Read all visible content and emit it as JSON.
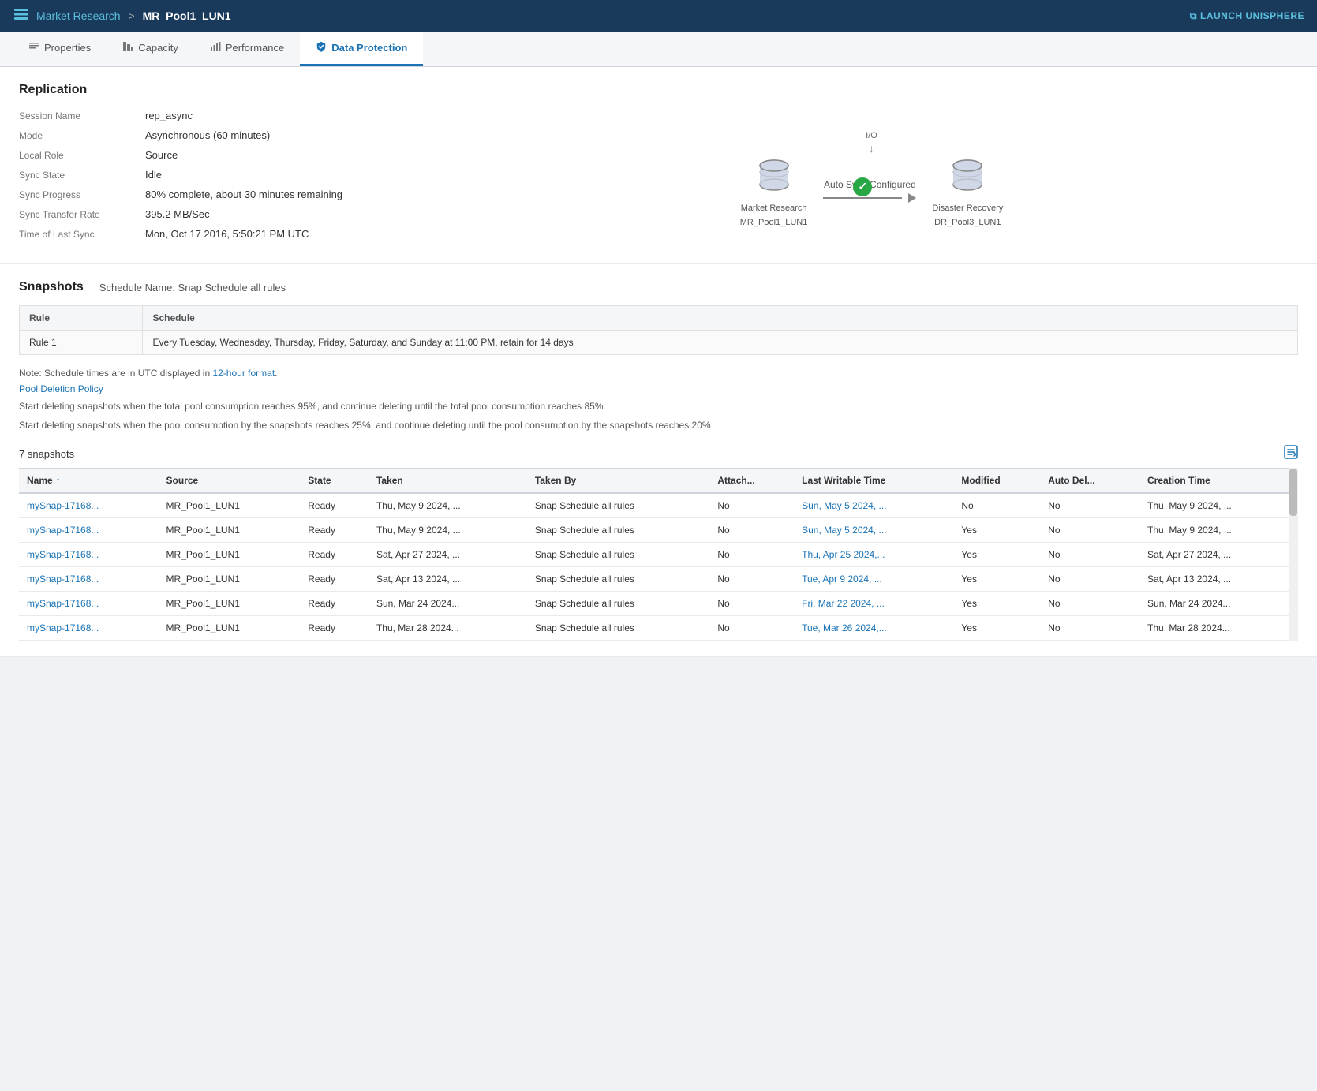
{
  "topBar": {
    "logoIcon": "☰",
    "breadcrumb": {
      "parent": "Market Research",
      "separator": ">",
      "current": "MR_Pool1_LUN1"
    },
    "launchButton": "LAUNCH UNISPHERE"
  },
  "tabs": [
    {
      "id": "properties",
      "label": "Properties",
      "icon": "☰",
      "active": false
    },
    {
      "id": "capacity",
      "label": "Capacity",
      "icon": "⊞",
      "active": false
    },
    {
      "id": "performance",
      "label": "Performance",
      "icon": "📊",
      "active": false
    },
    {
      "id": "dataProtection",
      "label": "Data Protection",
      "icon": "🛡",
      "active": true
    }
  ],
  "replication": {
    "title": "Replication",
    "fields": [
      {
        "label": "Session Name",
        "value": "rep_async"
      },
      {
        "label": "Mode",
        "value": "Asynchronous (60 minutes)"
      },
      {
        "label": "Local Role",
        "value": "Source"
      },
      {
        "label": "Sync State",
        "value": "Idle"
      },
      {
        "label": "Sync Progress",
        "value": "80% complete, about 30 minutes remaining"
      },
      {
        "label": "Sync Transfer Rate",
        "value": "395.2 MB/Sec"
      },
      {
        "label": "Time of Last Sync",
        "value": "Mon, Oct 17 2016, 5:50:21 PM UTC"
      }
    ],
    "diagram": {
      "ioLabel": "I/O",
      "syncLabel": "Auto Sync Configured",
      "source": {
        "name": "Market Research",
        "lun": "MR_Pool1_LUN1"
      },
      "destination": {
        "name": "Disaster Recovery",
        "lun": "DR_Pool3_LUN1"
      }
    }
  },
  "snapshots": {
    "title": "Snapshots",
    "scheduleLabel": "Schedule Name: Snap Schedule all rules",
    "tableHeaders": [
      "Rule",
      "Schedule"
    ],
    "tableRows": [
      {
        "rule": "Rule 1",
        "schedule": "Every Tuesday, Wednesday, Thursday, Friday, Saturday, and Sunday at 11:00 PM, retain for 14 days"
      }
    ],
    "noteText": "Note: Schedule times are in UTC displayed in 12-hour format.",
    "poolDeletionPolicyLabel": "Pool Deletion Policy",
    "policies": [
      "Start deleting snapshots when the total pool consumption reaches 95%, and continue deleting until the total pool consumption reaches 85%",
      "Start deleting snapshots when the pool consumption by the snapshots reaches 25%, and continue deleting until the pool consumption by the snapshots reaches 20%"
    ],
    "count": "7 snapshots",
    "dataTable": {
      "headers": [
        {
          "label": "Name",
          "sortable": true,
          "sortDir": "asc"
        },
        {
          "label": "Source",
          "sortable": false
        },
        {
          "label": "State",
          "sortable": false
        },
        {
          "label": "Taken",
          "sortable": false
        },
        {
          "label": "Taken By",
          "sortable": false
        },
        {
          "label": "Attach...",
          "sortable": false
        },
        {
          "label": "Last Writable Time",
          "sortable": false
        },
        {
          "label": "Modified",
          "sortable": false
        },
        {
          "label": "Auto Del...",
          "sortable": false
        },
        {
          "label": "Creation Time",
          "sortable": false
        }
      ],
      "rows": [
        {
          "name": "mySnap-17168...",
          "source": "MR_Pool1_LUN1",
          "state": "Ready",
          "taken": "Thu, May 9 2024, ...",
          "takenBy": "Snap Schedule all rules",
          "attached": "No",
          "lastWritable": "Sun, May 5 2024, ...",
          "modified": "No",
          "autoDel": "No",
          "creationTime": "Thu, May 9 2024, ..."
        },
        {
          "name": "mySnap-17168...",
          "source": "MR_Pool1_LUN1",
          "state": "Ready",
          "taken": "Thu, May 9 2024, ...",
          "takenBy": "Snap Schedule all rules",
          "attached": "No",
          "lastWritable": "Sun, May 5 2024, ...",
          "modified": "Yes",
          "autoDel": "No",
          "creationTime": "Thu, May 9 2024, ..."
        },
        {
          "name": "mySnap-17168...",
          "source": "MR_Pool1_LUN1",
          "state": "Ready",
          "taken": "Sat, Apr 27 2024, ...",
          "takenBy": "Snap Schedule all rules",
          "attached": "No",
          "lastWritable": "Thu, Apr 25 2024,...",
          "modified": "Yes",
          "autoDel": "No",
          "creationTime": "Sat, Apr 27 2024, ..."
        },
        {
          "name": "mySnap-17168...",
          "source": "MR_Pool1_LUN1",
          "state": "Ready",
          "taken": "Sat, Apr 13 2024, ...",
          "takenBy": "Snap Schedule all rules",
          "attached": "No",
          "lastWritable": "Tue, Apr 9 2024, ...",
          "modified": "Yes",
          "autoDel": "No",
          "creationTime": "Sat, Apr 13 2024, ..."
        },
        {
          "name": "mySnap-17168...",
          "source": "MR_Pool1_LUN1",
          "state": "Ready",
          "taken": "Sun, Mar 24 2024...",
          "takenBy": "Snap Schedule all rules",
          "attached": "No",
          "lastWritable": "Fri, Mar 22 2024, ...",
          "modified": "Yes",
          "autoDel": "No",
          "creationTime": "Sun, Mar 24 2024..."
        },
        {
          "name": "mySnap-17168...",
          "source": "MR_Pool1_LUN1",
          "state": "Ready",
          "taken": "Thu, Mar 28 2024...",
          "takenBy": "Snap Schedule all rules",
          "attached": "No",
          "lastWritable": "Tue, Mar 26 2024,...",
          "modified": "Yes",
          "autoDel": "No",
          "creationTime": "Thu, Mar 28 2024..."
        }
      ]
    }
  }
}
